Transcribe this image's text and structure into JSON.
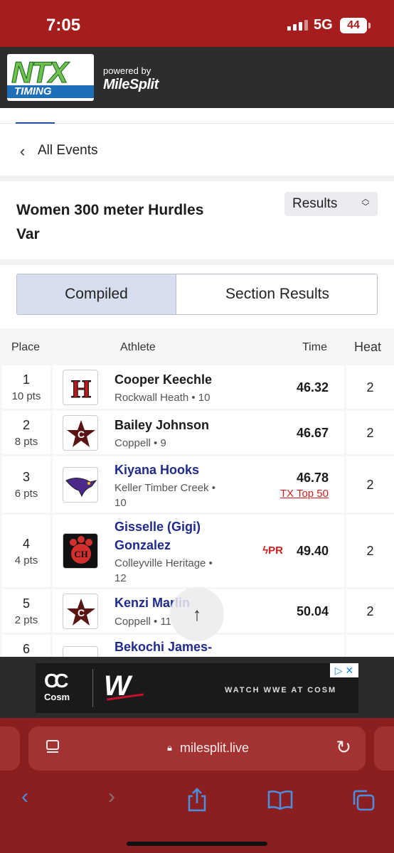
{
  "status_bar": {
    "time": "7:05",
    "network": "5G",
    "battery": "44"
  },
  "brand": {
    "logo_top": "NTX",
    "logo_bottom": "TIMING",
    "powered_by": "powered by",
    "partner": "MileSplit"
  },
  "nav": {
    "back_label": "All Events"
  },
  "event": {
    "title": "Women 300 meter Hurdles Var",
    "view_select": "Results"
  },
  "tabs": {
    "compiled": "Compiled",
    "sections": "Section Results"
  },
  "table": {
    "headers": {
      "place": "Place",
      "athlete": "Athlete",
      "time": "Time",
      "heat": "Heat"
    },
    "rows": [
      {
        "place": "1",
        "points": "10 pts",
        "name": "Cooper Keechle",
        "team_line": "Rockwall Heath • 10",
        "time": "46.32",
        "heat": "2",
        "logo": "H"
      },
      {
        "place": "2",
        "points": "8 pts",
        "name": "Bailey Johnson",
        "team_line": "Coppell • 9",
        "time": "46.67",
        "heat": "2",
        "logo": "C"
      },
      {
        "place": "3",
        "points": "6 pts",
        "name": "Kiyana Hooks",
        "team_line_1": "Keller Timber Creek •",
        "team_line_2": "10",
        "time": "46.78",
        "badge": "TX Top 50",
        "heat": "2",
        "logo": "falcon"
      },
      {
        "place": "4",
        "points": "4 pts",
        "name_1": "Gisselle (Gigi)",
        "name_2": "Gonzalez",
        "team_line_1": "Colleyville Heritage •",
        "team_line_2": "12",
        "pr": "PR",
        "time": "49.40",
        "heat": "2",
        "logo": "CH"
      },
      {
        "place": "5",
        "points": "2 pts",
        "name": "Kenzi Marlin",
        "team_line": "Coppell • 11",
        "time": "50.04",
        "heat": "2",
        "logo": "C"
      },
      {
        "place": "6",
        "name": "Bekochi James-"
      }
    ]
  },
  "ad": {
    "brand": "Cosm",
    "text": "WATCH WWE AT COSM",
    "close": "▷ ✕"
  },
  "browser": {
    "url": "milesplit.live"
  },
  "colors": {
    "status_bg": "#a51d1d",
    "link_blue": "#1f2a8a",
    "accent_red": "#d11d1d",
    "tab_active": "#d7deee",
    "browser_bg": "#8b1f1f"
  }
}
